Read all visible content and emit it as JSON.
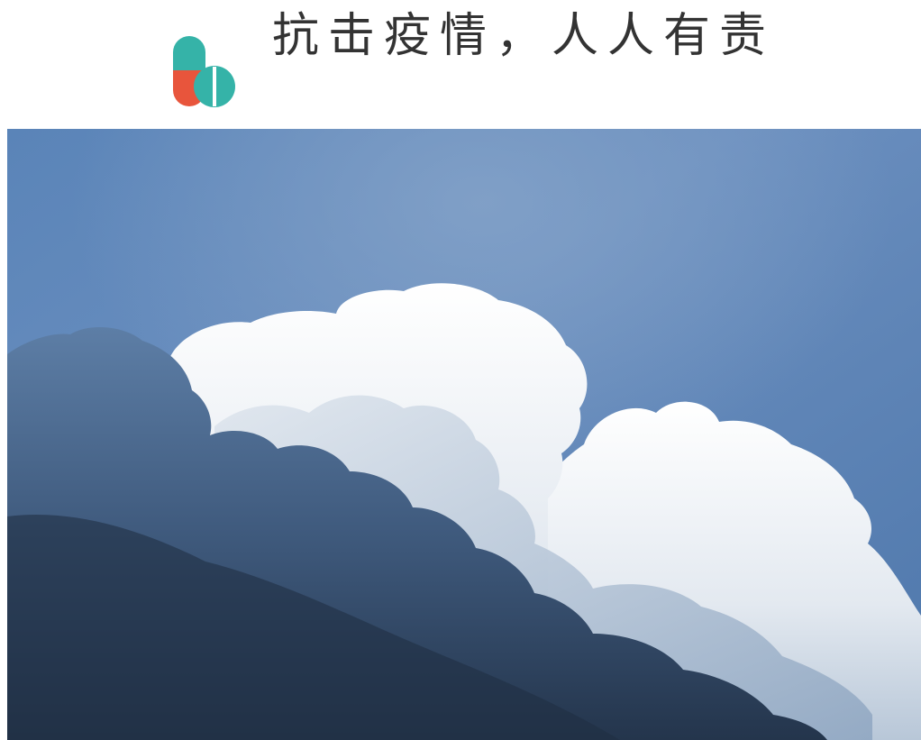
{
  "header": {
    "slogan": "抗击疫情，人人有责",
    "logo_icon": "pill-capsule-icon",
    "colors": {
      "teal": "#35b3a8",
      "red": "#e8553c",
      "text": "#333333"
    }
  },
  "photo": {
    "subject": "cumulus-clouds-blue-sky",
    "colors": {
      "sky": "#5f86b6",
      "cloud_highlight": "#f4f6f8",
      "cloud_shadow": "#2f4663"
    }
  }
}
